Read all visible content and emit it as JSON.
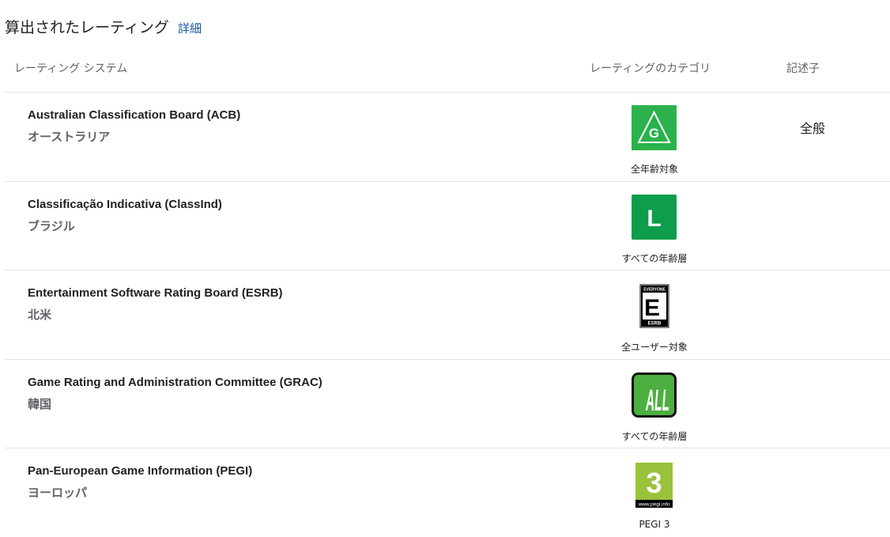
{
  "header": {
    "title": "算出されたレーティング",
    "details_link": "詳細"
  },
  "columns": {
    "system": "レーティング システム",
    "category": "レーティングのカテゴリ",
    "descriptor": "記述子"
  },
  "rows": [
    {
      "name": "Australian Classification Board (ACB)",
      "region": "オーストラリア",
      "icon_label": "G",
      "rating": "全年齢対象",
      "descriptor": "全般",
      "icon": "acb-g-icon",
      "color": "#2bb24c"
    },
    {
      "name": "Classificação Indicativa (ClassInd)",
      "region": "ブラジル",
      "icon_label": "L",
      "rating": "すべての年齢層",
      "descriptor": "",
      "icon": "classind-l-icon",
      "color": "#0d9d4c"
    },
    {
      "name": "Entertainment Software Rating Board (ESRB)",
      "region": "北米",
      "icon_label": "E",
      "icon_top_text": "EVERYONE",
      "icon_bottom_text": "ESRB",
      "rating": "全ユーザー対象",
      "descriptor": "",
      "icon": "esrb-everyone-icon",
      "color": "#000000"
    },
    {
      "name": "Game Rating and Administration Committee (GRAC)",
      "region": "韓国",
      "icon_label": "ALL",
      "rating": "すべての年齢層",
      "descriptor": "",
      "icon": "grac-all-icon",
      "color": "#4caf3f"
    },
    {
      "name": "Pan-European Game Information (PEGI)",
      "region": "ヨーロッパ",
      "icon_label": "3",
      "icon_bottom_text": "www.pegi.info",
      "rating": "PEGI 3",
      "descriptor": "",
      "icon": "pegi-3-icon",
      "color": "#9bc23c"
    }
  ]
}
